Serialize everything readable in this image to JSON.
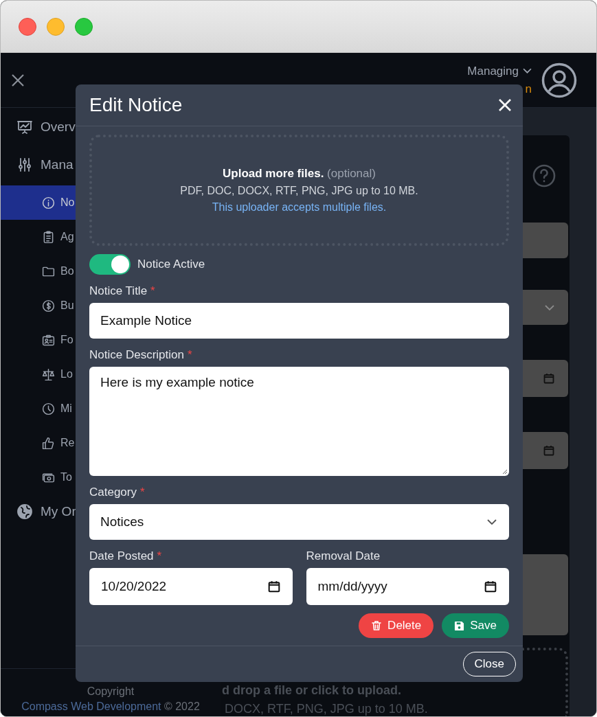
{
  "header": {
    "managing_label": "Managing",
    "organization": "n"
  },
  "sidebar": {
    "items": [
      {
        "label": "Overv",
        "selected": false
      },
      {
        "label": "Mana",
        "selected": false,
        "children": [
          {
            "label": "No",
            "selected": true
          },
          {
            "label": "Ag",
            "selected": false
          },
          {
            "label": "Bo",
            "selected": false
          },
          {
            "label": "Bu",
            "selected": false
          },
          {
            "label": "Fo",
            "selected": false
          },
          {
            "label": "Lo",
            "selected": false
          },
          {
            "label": "Mi",
            "selected": false
          },
          {
            "label": "Re",
            "selected": false
          },
          {
            "label": "To",
            "selected": false
          }
        ]
      },
      {
        "label": "My Or",
        "selected": false
      }
    ],
    "footer": {
      "prefix": "Copyright",
      "link": "Compass Web Development",
      "suffix": "© 2022"
    }
  },
  "background_upload": {
    "line_1": "d drop a file or click to upload.",
    "line_2": "DOCX, RTF, PNG, JPG up to 10 MB."
  },
  "modal": {
    "title": "Edit Notice",
    "upload": {
      "prompt": "**Upload more files.** (optional)",
      "formats": "PDF, DOC, DOCX, RTF, PNG, JPG up to 10 MB.",
      "note": "This uploader accepts multiple files."
    },
    "active_toggle": {
      "label": "Notice Active",
      "on": true
    },
    "fields": [
      {
        "kind": "text",
        "label": "Notice Title",
        "required_mark": "*",
        "value": "Example Notice"
      },
      {
        "kind": "textarea",
        "label": "Notice Description",
        "required_mark": "*",
        "value": "Here is my example notice"
      },
      {
        "kind": "select",
        "label": "Category",
        "required_mark": "*",
        "value": "Notices"
      }
    ],
    "dates": [
      {
        "label": "Date Posted",
        "required_mark": "*",
        "value": "10/20/2022"
      },
      {
        "label": "Removal Date",
        "placeholder": "mm/dd/yyyy"
      }
    ],
    "actions": [
      {
        "kind": "delete",
        "label": "Delete"
      },
      {
        "kind": "save",
        "label": "Save"
      }
    ],
    "close_label": "Close"
  }
}
